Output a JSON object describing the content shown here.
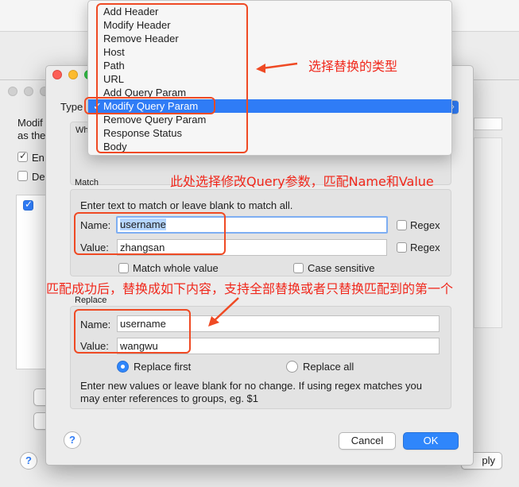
{
  "background_window": {
    "left_texts": [
      "Modif",
      "as the",
      "En",
      "De"
    ],
    "apply_label": "ply"
  },
  "dialog": {
    "type_label": "Type",
    "cut_label": "Wh",
    "match": {
      "title": "Match",
      "hint": "Enter text to match or leave blank to match all.",
      "name_label": "Name:",
      "name_value": "username",
      "value_label": "Value:",
      "value_value": "zhangsan",
      "regex_label": "Regex",
      "match_whole_label": "Match whole value",
      "case_sensitive_label": "Case sensitive"
    },
    "replace": {
      "title": "Replace",
      "name_label": "Name:",
      "name_value": "username",
      "value_label": "Value:",
      "value_value": "wangwu",
      "replace_first_label": "Replace first",
      "replace_all_label": "Replace all",
      "hint": "Enter new values or leave blank for no change. If using regex matches you may enter references to groups, eg. $1",
      "selected_mode": "Replace first"
    },
    "help_label": "?",
    "cancel_label": "Cancel",
    "ok_label": "OK"
  },
  "type_menu": {
    "items": [
      "Add Header",
      "Modify Header",
      "Remove Header",
      "Host",
      "Path",
      "URL",
      "Add Query Param",
      "Modify Query Param",
      "Remove Query Param",
      "Response Status",
      "Body"
    ],
    "selected": "Modify Query Param",
    "check_mark": "✓"
  },
  "annotations": {
    "note1": "选择替换的类型",
    "note2": "此处选择修改Query参数，匹配Name和Value",
    "note3": "匹配成功后，替换成如下内容，支持全部替换或者只替换匹配到的第一个"
  },
  "colors": {
    "accent": "#2f7cf6",
    "annotation": "#f0281c"
  }
}
